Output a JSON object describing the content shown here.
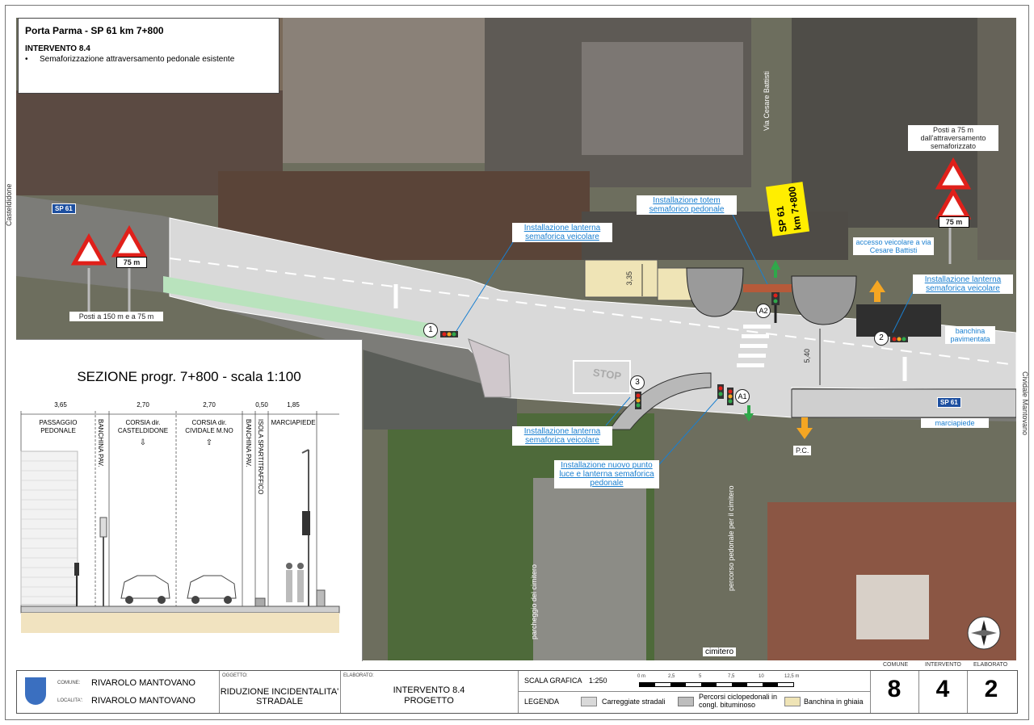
{
  "title": {
    "main": "Porta Parma - SP 61 km 7+800",
    "intervento": "INTERVENTO 8.4",
    "bullet": "Semaforizzazione attraversamento pedonale esistente"
  },
  "map": {
    "street_vertical": "Via Cesare Battisti",
    "left_direction": "Casteldidone",
    "right_direction": "Cividale Mantovano",
    "road_badge": "SP 61",
    "km_sign_line1": "SP 61",
    "km_sign_line2": "km 7+800",
    "sign_distance": "75 m",
    "label_left_signs": "Posti a 150 m e a 75 m",
    "label_right_signs": "Posti a 75 m dall'attraversamento semaforizzato",
    "label_lantern_1": "Installazione lanterna semaforica veicolare",
    "label_totem": "Installazione totem semaforico pedonale",
    "label_access": "accesso veicolare a via Cesare Battisti",
    "label_lantern_2": "Installazione lanterna semaforica veicolare",
    "label_banchina": "banchina pavimentata",
    "label_marciapiede": "marciapiede",
    "label_lantern_3": "Installazione lanterna semaforica veicolare",
    "label_nuovo": "Installazione nuovo punto luce e lanterna semaforica pedonale",
    "label_percorso": "percorso pedonale per il cimitero",
    "label_parcheggio": "parcheggio del cimitero",
    "label_cimitero": "cimitero",
    "label_pc": "P.C.",
    "label_stop": "STOP",
    "dim_1": "3,35",
    "dim_2": "5,40",
    "marker_1": "1",
    "marker_2": "2",
    "marker_3": "3",
    "marker_a1": "A1",
    "marker_a2": "A2"
  },
  "section": {
    "title": "SEZIONE progr. 7+800 - scala 1:100",
    "widths": [
      "3,65",
      "2,70",
      "2,70",
      "0,50",
      "1,85"
    ],
    "col_passaggio": "PASSAGGIO PEDONALE",
    "col_banchina1": "BANCHINA PAV.",
    "col_corsia1": "CORSIA dir. CASTELDIDONE",
    "col_corsia2": "CORSIA dir. CIVIDALE M.NO",
    "col_banchina2": "BANCHINA PAV.",
    "col_isola": "ISOLA SPARTITRAFFICO",
    "col_marciapiede": "MARCIAPIEDE"
  },
  "footer": {
    "comune_label": "COMUNE:",
    "comune": "RIVAROLO MANTOVANO",
    "localita_label": "LOCALITA':",
    "localita": "RIVAROLO MANTOVANO",
    "oggetto_label": "OGGETTO:",
    "oggetto": "RIDUZIONE INCIDENTALITA' STRADALE",
    "elaborato_label": "ELABORATO:",
    "elaborato_line1": "INTERVENTO 8.4",
    "elaborato_line2": "PROGETTO",
    "scala_label": "SCALA GRAFICA",
    "scala": "1:250",
    "scale_ticks": [
      "0 m",
      "2,5",
      "5",
      "7,5",
      "10",
      "12,5 m"
    ],
    "legenda_label": "LEGENDA",
    "legend_1": "Carreggiate stradali",
    "legend_2": "Percorsi ciclopedonali in congl. bituminoso",
    "legend_3": "Banchina in ghiaia",
    "col_comune": "COMUNE",
    "col_intervento": "INTERVENTO",
    "col_elaborato": "ELABORATO",
    "num_comune": "8",
    "num_intervento": "4",
    "num_elaborato": "2"
  },
  "colors": {
    "road": "#d9d9d9",
    "cycle": "#bdbdbd",
    "green_strip": "#b9e3bd",
    "link_blue": "#1a7fd0",
    "sign_red": "#e0201a",
    "arrow_orange": "#f5a623",
    "arrow_green": "#2fa84a",
    "sp_blue": "#1d4fa0"
  }
}
